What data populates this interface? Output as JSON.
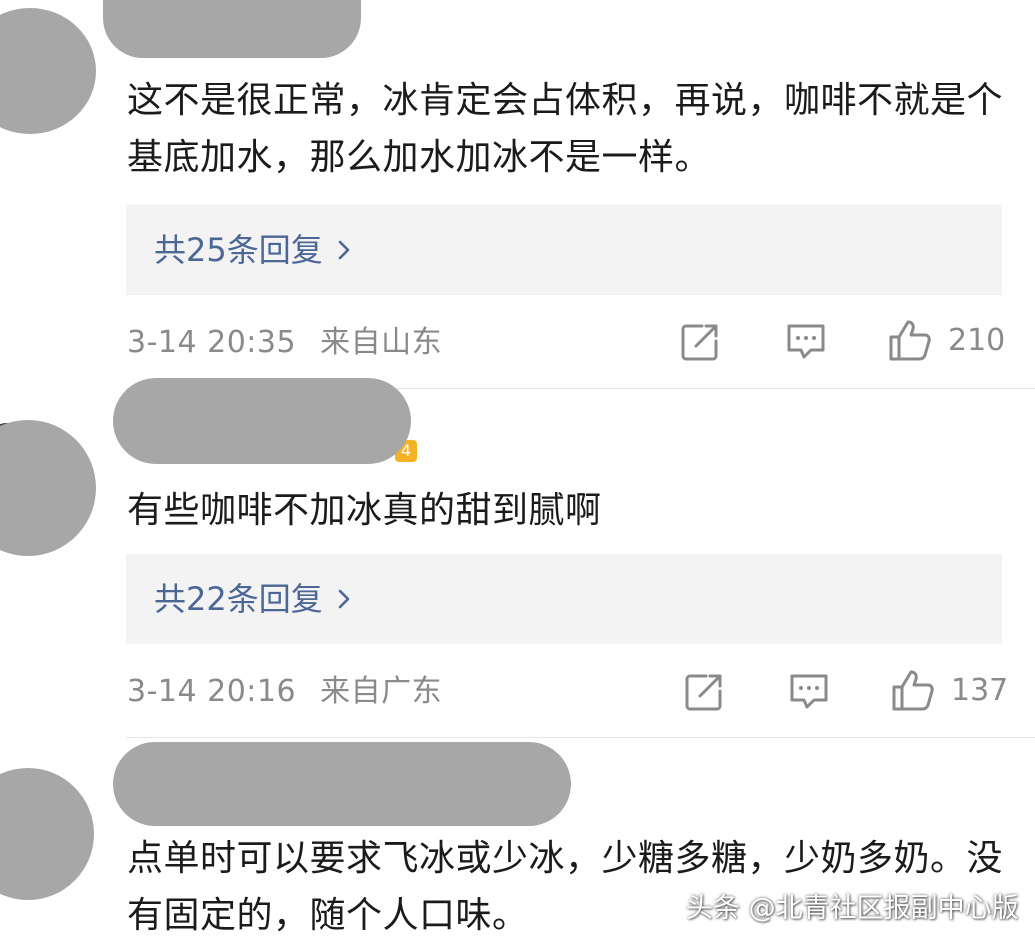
{
  "comments": [
    {
      "text": "这不是很正常，冰肯定会占体积，再说，咖啡不就是个基底加水，那么加水加冰不是一样。",
      "replies_label": "共25条回复",
      "timestamp": "3-14 20:35",
      "location": "来自山东",
      "likes": "210"
    },
    {
      "text": "有些咖啡不加冰真的甜到腻啊",
      "replies_label": "共22条回复",
      "timestamp": "3-14 20:16",
      "location": "来自广东",
      "likes": "137"
    },
    {
      "text": "点单时可以要求飞冰或少冰，少糖多糖，少奶多奶。没有固定的，随个人口味。"
    }
  ],
  "watermark": "头条 @北青社区报副中心版",
  "icons": {
    "repost": "share-edit-icon",
    "comment": "comment-bubble-icon",
    "like": "thumbs-up-icon",
    "reply": "chevron-right-icon"
  },
  "colors": {
    "reply_link": "#4a6795",
    "meta_text": "#8a8a8a",
    "reply_bg": "#f3f3f3",
    "redaction": "#a7a7a7"
  }
}
